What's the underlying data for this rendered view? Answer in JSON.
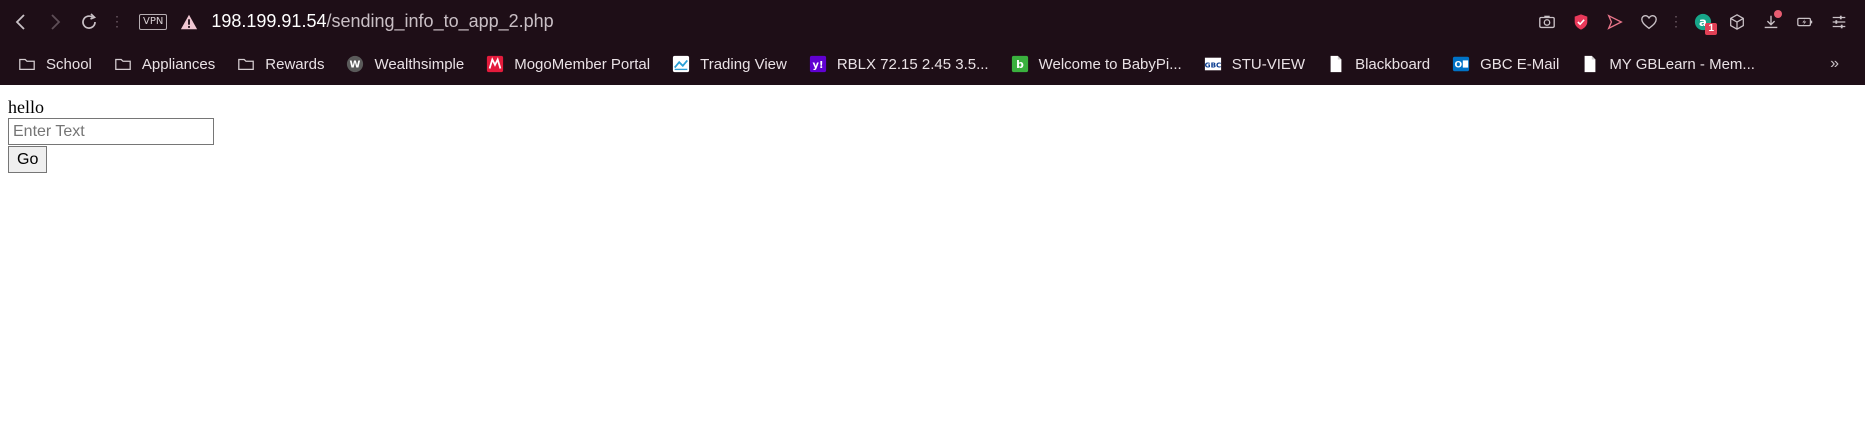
{
  "browser": {
    "vpn_label": "VPN",
    "url_host": "198.199.91.54",
    "url_path": "/sending_info_to_app_2.php",
    "extension_badge": "1",
    "bookmarks": [
      {
        "label": "School",
        "icon": "folder-icon"
      },
      {
        "label": "Appliances",
        "icon": "folder-icon"
      },
      {
        "label": "Rewards",
        "icon": "folder-icon"
      },
      {
        "label": "Wealthsimple",
        "icon": "wealthsimple-icon"
      },
      {
        "label": "MogoMember Portal",
        "icon": "mogo-icon"
      },
      {
        "label": "Trading View",
        "icon": "tradingview-icon"
      },
      {
        "label": "RBLX 72.15 2.45 3.5...",
        "icon": "yahoo-icon"
      },
      {
        "label": "Welcome to BabyPi...",
        "icon": "babypips-icon"
      },
      {
        "label": "STU-VIEW",
        "icon": "gbc-icon"
      },
      {
        "label": "Blackboard",
        "icon": "page-icon"
      },
      {
        "label": "GBC E-Mail",
        "icon": "outlook-icon"
      },
      {
        "label": "MY GBLearn - Mem...",
        "icon": "page-icon"
      }
    ]
  },
  "page": {
    "greeting": "hello",
    "input_placeholder": "Enter Text",
    "go_label": "Go"
  }
}
